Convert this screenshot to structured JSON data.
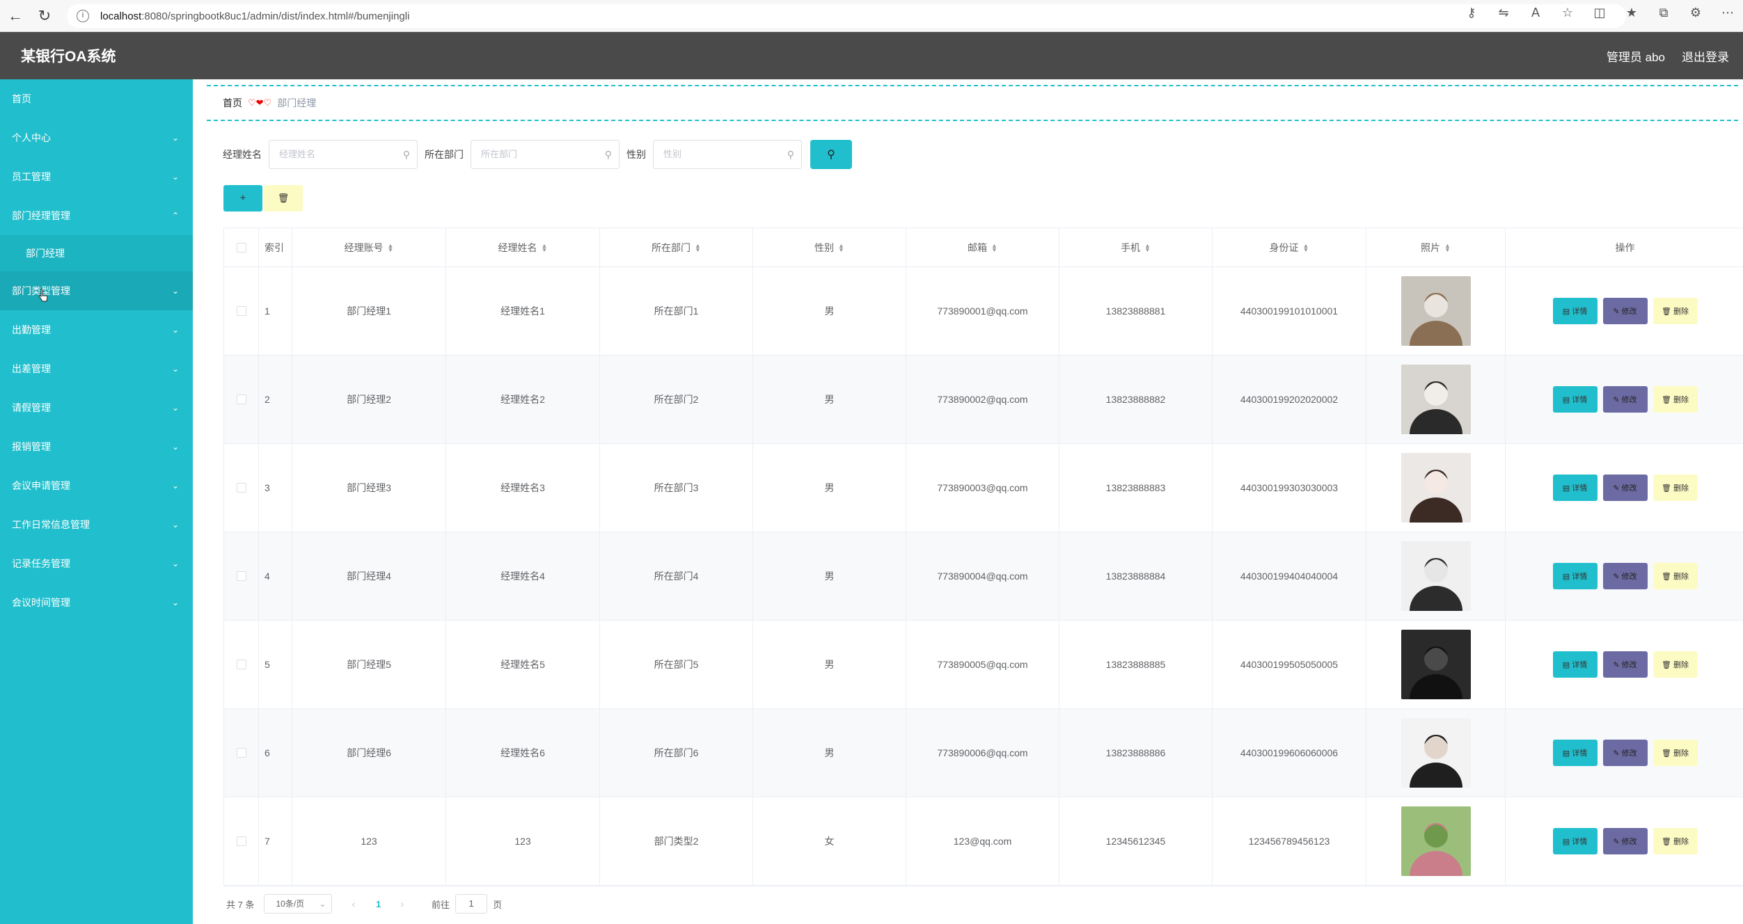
{
  "browser": {
    "url_host": "localhost",
    "url_rest": ":8080/springbootk8uc1/admin/dist/index.html#/bumenjingli"
  },
  "header": {
    "title": "某银行OA系统",
    "user": "管理员 abo",
    "logout": "退出登录"
  },
  "sidebar": {
    "items": [
      {
        "label": "首页"
      },
      {
        "label": "个人中心"
      },
      {
        "label": "员工管理"
      },
      {
        "label": "部门经理管理"
      },
      {
        "label": "部门经理"
      },
      {
        "label": "部门类型管理"
      },
      {
        "label": "出勤管理"
      },
      {
        "label": "出差管理"
      },
      {
        "label": "请假管理"
      },
      {
        "label": "报销管理"
      },
      {
        "label": "会议申请管理"
      },
      {
        "label": "工作日常信息管理"
      },
      {
        "label": "记录任务管理"
      },
      {
        "label": "会议时间管理"
      }
    ]
  },
  "breadcrumb": {
    "home": "首页",
    "current": "部门经理"
  },
  "search": {
    "name_label": "经理姓名",
    "name_placeholder": "经理姓名",
    "dept_label": "所在部门",
    "dept_placeholder": "所在部门",
    "gender_label": "性别",
    "gender_placeholder": "性别"
  },
  "table": {
    "headers": [
      "索引",
      "经理账号",
      "经理姓名",
      "所在部门",
      "性别",
      "邮箱",
      "手机",
      "身份证",
      "照片",
      "操作"
    ],
    "rows": [
      {
        "idx": "1",
        "account": "部门经理1",
        "name": "经理姓名1",
        "dept": "所在部门1",
        "gender": "男",
        "email": "773890001@qq.com",
        "phone": "13823888881",
        "idcard": "440300199101010001"
      },
      {
        "idx": "2",
        "account": "部门经理2",
        "name": "经理姓名2",
        "dept": "所在部门2",
        "gender": "男",
        "email": "773890002@qq.com",
        "phone": "13823888882",
        "idcard": "440300199202020002"
      },
      {
        "idx": "3",
        "account": "部门经理3",
        "name": "经理姓名3",
        "dept": "所在部门3",
        "gender": "男",
        "email": "773890003@qq.com",
        "phone": "13823888883",
        "idcard": "440300199303030003"
      },
      {
        "idx": "4",
        "account": "部门经理4",
        "name": "经理姓名4",
        "dept": "所在部门4",
        "gender": "男",
        "email": "773890004@qq.com",
        "phone": "13823888884",
        "idcard": "440300199404040004"
      },
      {
        "idx": "5",
        "account": "部门经理5",
        "name": "经理姓名5",
        "dept": "所在部门5",
        "gender": "男",
        "email": "773890005@qq.com",
        "phone": "13823888885",
        "idcard": "440300199505050005"
      },
      {
        "idx": "6",
        "account": "部门经理6",
        "name": "经理姓名6",
        "dept": "所在部门6",
        "gender": "男",
        "email": "773890006@qq.com",
        "phone": "13823888886",
        "idcard": "440300199606060006"
      },
      {
        "idx": "7",
        "account": "123",
        "name": "123",
        "dept": "部门类型2",
        "gender": "女",
        "email": "123@qq.com",
        "phone": "12345612345",
        "idcard": "123456789456123"
      }
    ],
    "ops": {
      "detail": "详情",
      "edit": "修改",
      "delete": "删除"
    }
  },
  "pager": {
    "total": "共 7 条",
    "size": "10条/页",
    "current": "1",
    "goto_prefix": "前往",
    "goto_value": "1",
    "goto_suffix": "页"
  },
  "colors": {
    "accent": "#21bfcd",
    "header_bg": "#4a4a4a",
    "edit_btn": "#6b6aa2",
    "delete_btn": "#fdfbc4"
  }
}
